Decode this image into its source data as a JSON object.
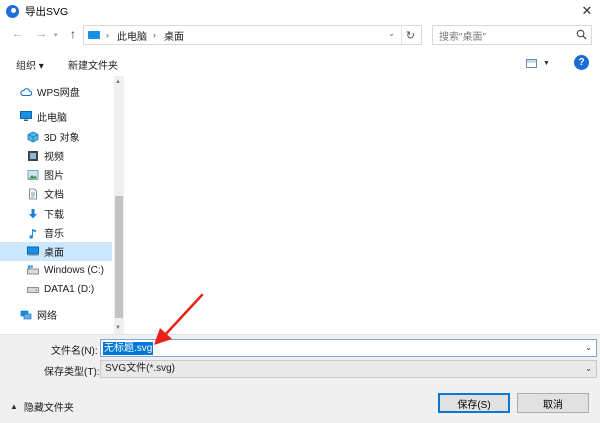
{
  "window": {
    "title": "导出SVG",
    "close_glyph": "✕"
  },
  "nav": {
    "back_glyph": "←",
    "forward_glyph": "→",
    "up_glyph": "↑",
    "address": [
      "此电脑",
      "桌面"
    ],
    "address_sep": "›",
    "refresh_glyph": "↻",
    "dropdown_glyph": "⌄",
    "search_placeholder": "搜索\"桌面\""
  },
  "toolbar": {
    "organize": "组织 ▾",
    "new_folder": "新建文件夹",
    "help": "?"
  },
  "sidebar": {
    "items": [
      {
        "label": "WPS网盘",
        "icon": "cloud-icon"
      },
      {
        "label": "此电脑",
        "icon": "computer-icon"
      },
      {
        "label": "3D 对象",
        "icon": "cube-icon"
      },
      {
        "label": "视频",
        "icon": "video-icon"
      },
      {
        "label": "图片",
        "icon": "picture-icon"
      },
      {
        "label": "文档",
        "icon": "document-icon"
      },
      {
        "label": "下载",
        "icon": "download-icon"
      },
      {
        "label": "音乐",
        "icon": "music-icon"
      },
      {
        "label": "桌面",
        "icon": "desktop-icon",
        "selected": true
      },
      {
        "label": "Windows (C:)",
        "icon": "drive-icon"
      },
      {
        "label": "DATA1 (D:)",
        "icon": "drive-icon"
      },
      {
        "label": "网络",
        "icon": "network-icon"
      }
    ]
  },
  "form": {
    "filename_label": "文件名(N):",
    "filename_value": "无标题.svg",
    "filetype_label": "保存类型(T):",
    "filetype_value": "SVG文件(*.svg)"
  },
  "footer": {
    "hide_folders": "隐藏文件夹",
    "save": "保存(S)",
    "cancel": "取消"
  },
  "colors": {
    "accent": "#0078d7",
    "selection": "#cce8ff",
    "annotation_arrow": "#e8211a"
  }
}
